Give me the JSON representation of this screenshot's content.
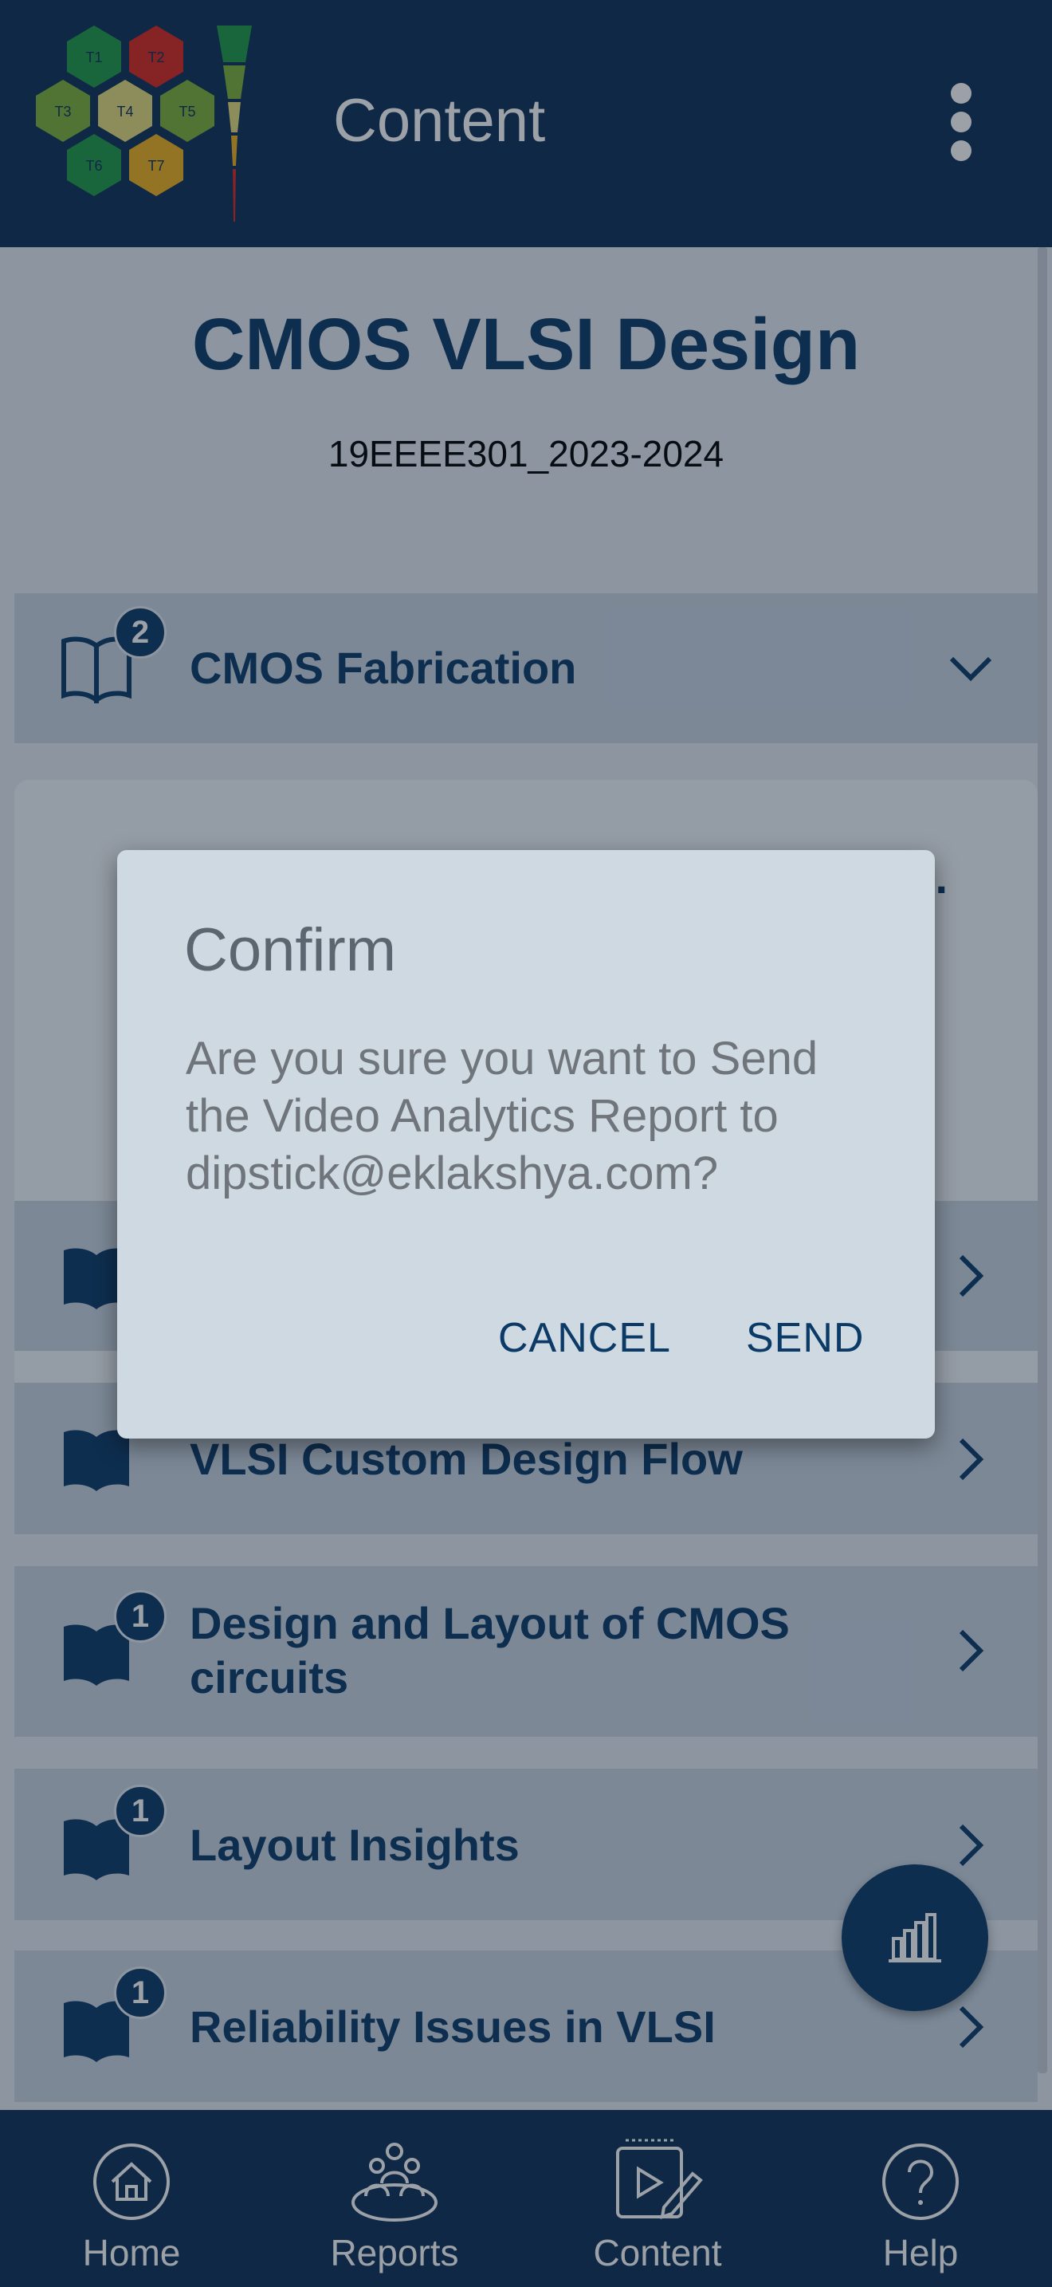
{
  "appbar": {
    "title": "Content",
    "logo_cells": [
      "T1",
      "T2",
      "T3",
      "T4",
      "T5",
      "T6",
      "T7"
    ],
    "menu_icon": "more-vert-icon"
  },
  "course": {
    "title": "CMOS VLSI Design",
    "code": "19EEEE301_2023-2024"
  },
  "modules": [
    {
      "label": "CMOS Fabrication",
      "badge": "2",
      "chevron": "expand-more"
    },
    {
      "label": "",
      "badge": "",
      "chevron": "chevron-right"
    },
    {
      "label": "VLSI Custom Design Flow",
      "badge": "",
      "chevron": "chevron-right"
    },
    {
      "label": "Design and Layout of CMOS circuits",
      "badge": "1",
      "chevron": "chevron-right"
    },
    {
      "label": "Layout Insights",
      "badge": "1",
      "chevron": "chevron-right"
    },
    {
      "label": "Reliability Issues in VLSI",
      "badge": "1",
      "chevron": "chevron-right"
    }
  ],
  "expanded_ellipsis": "..",
  "fab": {
    "icon": "bar-chart-icon"
  },
  "bottom_nav": [
    {
      "label": "Home",
      "icon": "home-icon"
    },
    {
      "label": "Reports",
      "icon": "people-group-icon"
    },
    {
      "label": "Content",
      "icon": "video-edit-icon"
    },
    {
      "label": "Help",
      "icon": "help-icon"
    }
  ],
  "dialog": {
    "title": "Confirm",
    "message": "Are you sure you want to Send the Video Analytics Report to dipstick@eklakshya.com?",
    "cancel": "CANCEL",
    "send": "SEND"
  },
  "colors": {
    "primary": "#0b2f55",
    "accent": "#0b3a67",
    "scrim": "rgba(18,30,48,0.42)"
  }
}
